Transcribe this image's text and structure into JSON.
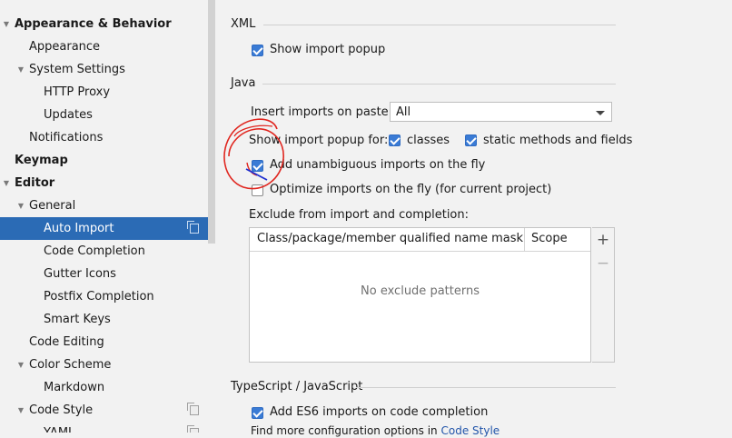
{
  "sidebar": {
    "items": [
      {
        "label": "Appearance & Behavior",
        "bold": true,
        "expander": "down"
      },
      {
        "label": "Appearance"
      },
      {
        "label": "System Settings",
        "expander": "down"
      },
      {
        "label": "HTTP Proxy"
      },
      {
        "label": "Updates"
      },
      {
        "label": "Notifications"
      },
      {
        "label": "Keymap",
        "bold": true
      },
      {
        "label": "Editor",
        "bold": true,
        "expander": "down"
      },
      {
        "label": "General",
        "expander": "down"
      },
      {
        "label": "Auto Import",
        "selected": true,
        "copy_icon": true
      },
      {
        "label": "Code Completion"
      },
      {
        "label": "Gutter Icons"
      },
      {
        "label": "Postfix Completion"
      },
      {
        "label": "Smart Keys"
      },
      {
        "label": "Code Editing"
      },
      {
        "label": "Color Scheme",
        "expander": "down"
      },
      {
        "label": "Markdown"
      },
      {
        "label": "Code Style",
        "expander": "down",
        "copy_icon": true
      },
      {
        "label": "YAML",
        "copy_icon": true
      }
    ]
  },
  "xml": {
    "title": "XML",
    "show_import_popup": {
      "label": "Show import popup",
      "checked": true
    }
  },
  "java": {
    "title": "Java",
    "insert_imports_label": "Insert imports on paste:",
    "insert_imports_value": "All",
    "show_popup_for_label": "Show import popup for:",
    "classes": {
      "label": "classes",
      "checked": true
    },
    "static_methods": {
      "label": "static methods and fields",
      "checked": true
    },
    "add_unambiguous": {
      "label": "Add unambiguous imports on the fly",
      "checked": true
    },
    "optimize_imports": {
      "label": "Optimize imports on the fly (for current project)",
      "checked": false
    },
    "exclude_label": "Exclude from import and completion:",
    "table": {
      "col_mask": "Class/package/member qualified name mask",
      "col_scope": "Scope",
      "empty_text": "No exclude patterns",
      "add": "+",
      "remove": "−"
    }
  },
  "typescript": {
    "title": "TypeScript / JavaScript",
    "add_es6": {
      "label": "Add ES6 imports on code completion",
      "checked": true
    },
    "more_text": "Find more configuration options in",
    "more_link": "Code Style"
  },
  "colors": {
    "selection": "#2b6bb5",
    "checkbox": "#3a7bd5",
    "annotation": "#e0261f",
    "annotation_stroke": "#1f2fd0",
    "link": "#2255aa"
  }
}
